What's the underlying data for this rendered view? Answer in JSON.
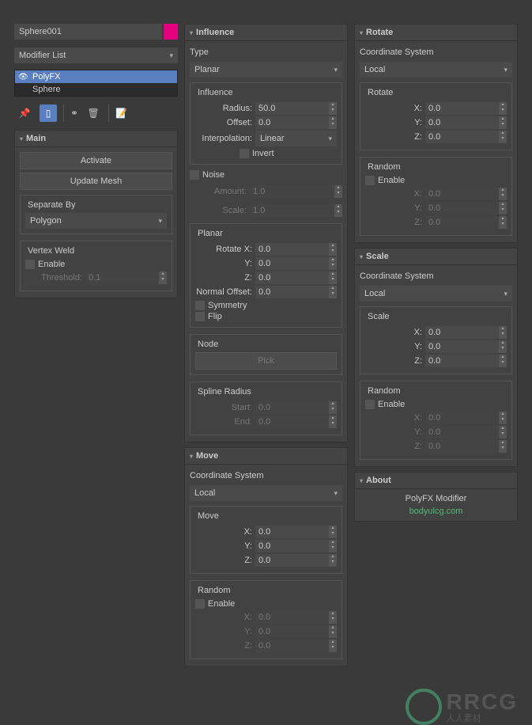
{
  "object_name": "Sphere001",
  "modifier_list_label": "Modifier List",
  "stack": {
    "polyfx": "PolyFX",
    "sphere": "Sphere"
  },
  "main": {
    "title": "Main",
    "activate": "Activate",
    "update_mesh": "Update Mesh",
    "separate_by": {
      "label": "Separate By",
      "value": "Polygon"
    },
    "vertex_weld": {
      "label": "Vertex Weld",
      "enable": "Enable",
      "threshold_label": "Threshold:",
      "threshold": "0.1"
    }
  },
  "influence": {
    "title": "Influence",
    "type_label": "Type",
    "type_value": "Planar",
    "influence_label": "Influence",
    "radius_label": "Radius:",
    "radius": "50.0",
    "offset_label": "Offset:",
    "offset": "0.0",
    "interp_label": "Interpolation:",
    "interp": "Linear",
    "invert": "Invert",
    "noise_label": "Noise",
    "noise_amount_label": "Amount:",
    "noise_amount": "1.0",
    "noise_scale_label": "Scale:",
    "noise_scale": "1.0",
    "planar_label": "Planar",
    "rotate_x_label": "Rotate X:",
    "rotate_x": "0.0",
    "y_label": "Y:",
    "y": "0.0",
    "z_label": "Z:",
    "z": "0.0",
    "normal_offset_label": "Normal Offset:",
    "normal_offset": "0.0",
    "symmetry": "Symmetry",
    "flip": "Flip",
    "node_label": "Node",
    "pick": "Pick",
    "spline_label": "Spline Radius",
    "start_label": "Start:",
    "start": "0.0",
    "end_label": "End:",
    "end": "0.0"
  },
  "move": {
    "title": "Move",
    "coord_label": "Coordinate System",
    "coord": "Local",
    "move_label": "Move",
    "x_label": "X:",
    "x": "0.0",
    "y_label": "Y:",
    "y": "0.0",
    "z_label": "Z:",
    "z": "0.0",
    "random_label": "Random",
    "enable": "Enable",
    "rx": "0.0",
    "ry": "0.0",
    "rz": "0.0"
  },
  "rotate": {
    "title": "Rotate",
    "coord_label": "Coordinate System",
    "coord": "Local",
    "rotate_label": "Rotate",
    "x_label": "X:",
    "x": "0.0",
    "y_label": "Y:",
    "y": "0.0",
    "z_label": "Z:",
    "z": "0.0",
    "random_label": "Random",
    "enable": "Enable",
    "rx": "0.0",
    "ry": "0.0",
    "rz": "0.0"
  },
  "scale": {
    "title": "Scale",
    "coord_label": "Coordinate System",
    "coord": "Local",
    "scale_label": "Scale",
    "x_label": "X:",
    "x": "0.0",
    "y_label": "Y:",
    "y": "0.0",
    "z_label": "Z:",
    "z": "0.0",
    "random_label": "Random",
    "enable": "Enable",
    "rx": "0.0",
    "ry": "0.0",
    "rz": "0.0"
  },
  "about": {
    "title": "About",
    "name": "PolyFX Modifier",
    "link": "bodyulcg.com"
  },
  "watermark": {
    "big": "RRCG",
    "sub": "人人素材"
  }
}
